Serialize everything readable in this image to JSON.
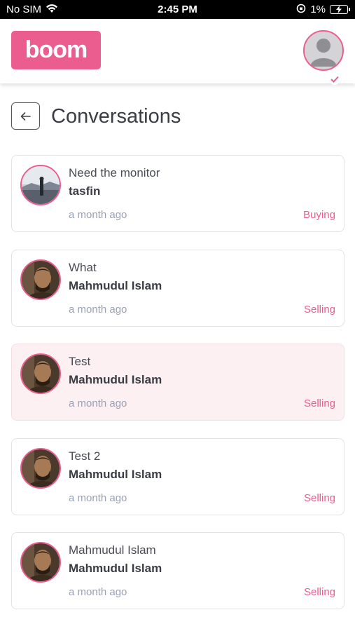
{
  "status_bar": {
    "carrier": "No SIM",
    "time": "2:45 PM",
    "battery": "1%"
  },
  "header": {
    "logo_text": "boom",
    "brand_color": "#ec5d8f"
  },
  "page": {
    "title": "Conversations"
  },
  "conversations": [
    {
      "subject": "Need the monitor",
      "name": "tasfin",
      "time": "a month ago",
      "type": "Buying",
      "avatar": "landscape-photo"
    },
    {
      "subject": "What",
      "name": "Mahmudul Islam",
      "time": "a month ago",
      "type": "Selling",
      "avatar": "man-photo"
    },
    {
      "subject": "Test",
      "name": "Mahmudul Islam",
      "time": "a month ago",
      "type": "Selling",
      "avatar": "man-photo",
      "highlighted": true
    },
    {
      "subject": "Test 2",
      "name": "Mahmudul Islam",
      "time": "a month ago",
      "type": "Selling",
      "avatar": "man-photo"
    },
    {
      "subject": "Mahmudul Islam",
      "name": "Mahmudul Islam",
      "time": "a month ago",
      "type": "Selling",
      "avatar": "man-photo"
    }
  ]
}
